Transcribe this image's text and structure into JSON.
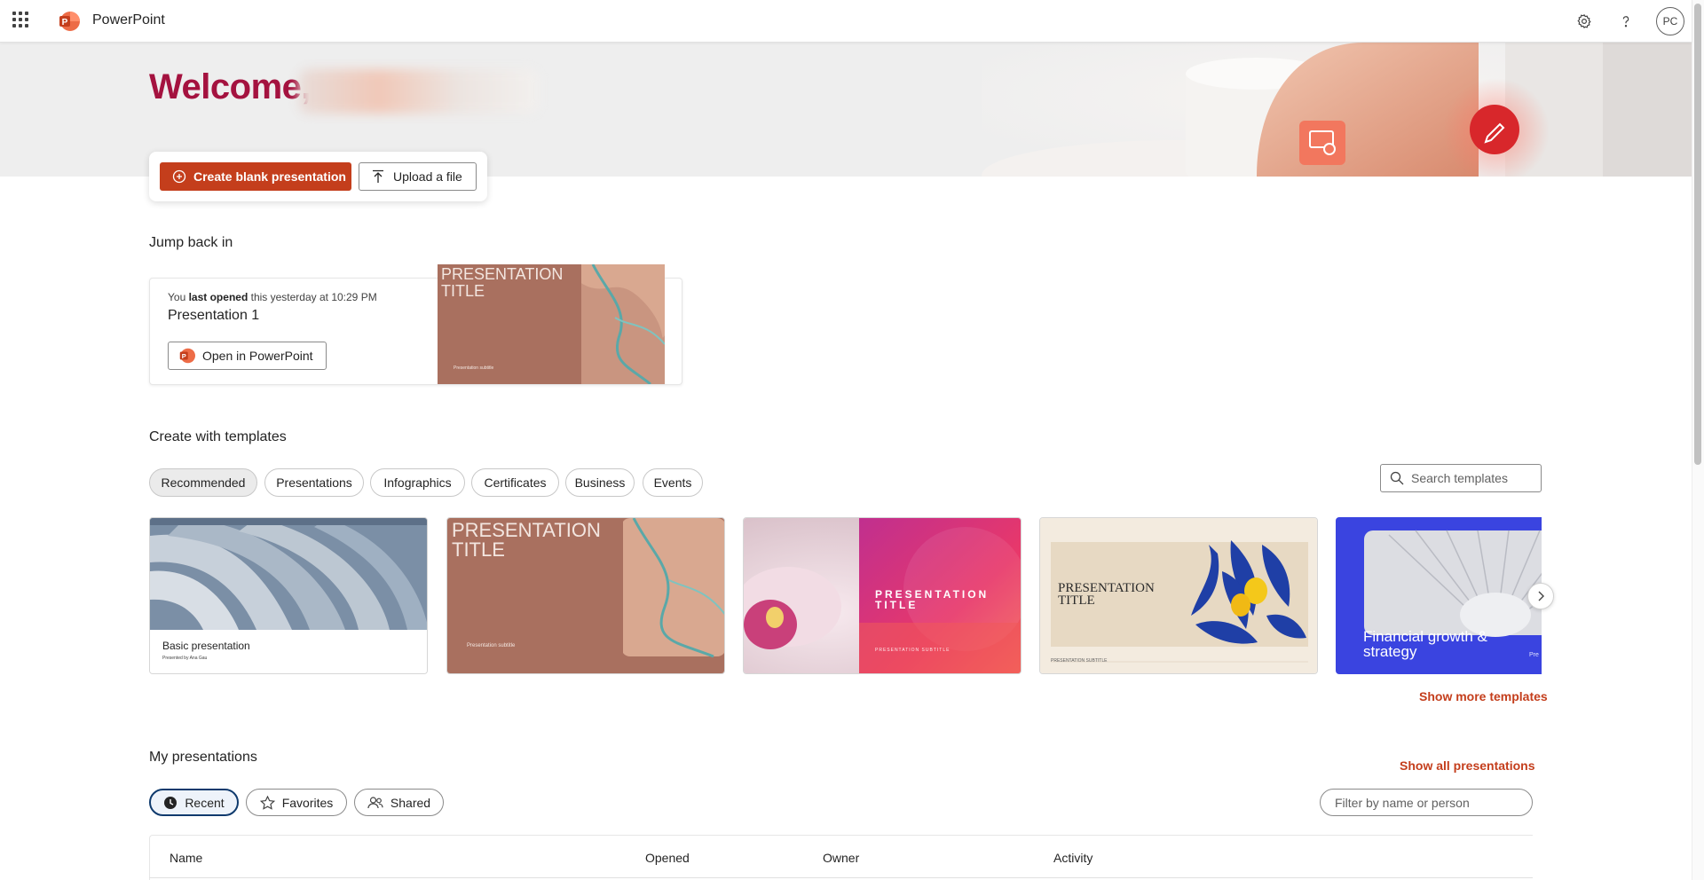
{
  "app": {
    "name": "PowerPoint",
    "avatar_initials": "PC",
    "brand_color": "#c43e1c",
    "welcome_color": "#a4123f"
  },
  "hero": {
    "welcome": "Welcome,"
  },
  "actions": {
    "create_label": "Create blank presentation",
    "upload_label": "Upload a file"
  },
  "jump_back": {
    "title": "Jump back in",
    "meta_prefix": "You ",
    "meta_bold": "last opened",
    "meta_suffix": " this yesterday at 10:29 PM",
    "file_name": "Presentation 1",
    "open_label": "Open in PowerPoint",
    "thumb_title": "PRESENTATION TITLE",
    "thumb_subtitle": "Presentation subtitle"
  },
  "templates": {
    "title": "Create with templates",
    "filters": [
      "Recommended",
      "Presentations",
      "Infographics",
      "Certificates",
      "Business",
      "Events"
    ],
    "active_filter": "Recommended",
    "search_placeholder": "Search templates",
    "cards": [
      {
        "caption": "Basic presentation",
        "sub": "Presented by Ana Gau"
      },
      {
        "title": "PRESENTATION TITLE",
        "sub": "Presentation subtitle"
      },
      {
        "title": "PRESENTATION TITLE",
        "sub": "PRESENTATION SUBTITLE"
      },
      {
        "title": "PRESENTATION TITLE",
        "sub": "PRESENTATION SUBTITLE"
      },
      {
        "title": "Financial growth & strategy",
        "sub": "Pre"
      }
    ],
    "show_more": "Show more templates"
  },
  "my_presentations": {
    "title": "My presentations",
    "show_all": "Show all presentations",
    "tabs": [
      "Recent",
      "Favorites",
      "Shared"
    ],
    "filter_placeholder": "Filter by name or person",
    "columns": [
      "Name",
      "Opened",
      "Owner",
      "Activity"
    ]
  }
}
